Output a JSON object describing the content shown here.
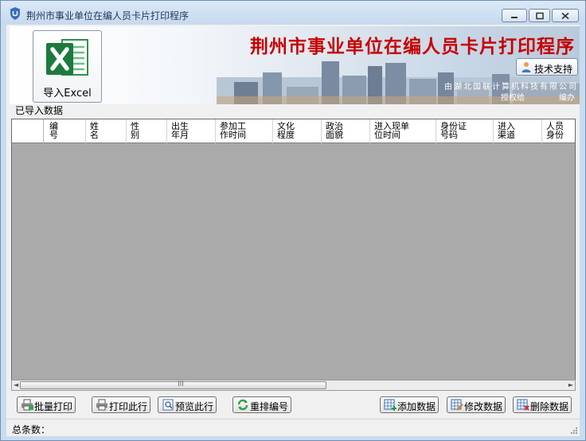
{
  "window": {
    "title": "荆州市事业单位在编人员卡片打印程序"
  },
  "banner": {
    "title": "荆州市事业单位在编人员卡片打印程序",
    "support_button": "技术支持",
    "company": "由湖北国联计算机科技有限公司",
    "authorized": "授权给",
    "compiled": "编办"
  },
  "import_button": {
    "label": "导入Excel",
    "icon": "excel-icon"
  },
  "section": {
    "label": "已导入数据"
  },
  "table": {
    "columns": [
      {
        "label": "编\n号"
      },
      {
        "label": "姓\n名"
      },
      {
        "label": "性\n别"
      },
      {
        "label": "出生\n年月"
      },
      {
        "label": "参加工\n作时间"
      },
      {
        "label": "文化\n程度"
      },
      {
        "label": "政治\n面貌"
      },
      {
        "label": "进入现单\n位时间"
      },
      {
        "label": "身份证\n号码"
      },
      {
        "label": "进入\n渠道"
      },
      {
        "label": "人员\n身份"
      }
    ],
    "rows": []
  },
  "scrollbar": {
    "left_arrow": "◄",
    "right_arrow": "►",
    "grip": "III"
  },
  "buttons": {
    "batch_print": "批量打印",
    "print_row": "打印此行",
    "preview_row": "预览此行",
    "renumber": "重排编号",
    "add_data": "添加数据",
    "edit_data": "修改数据",
    "delete_data": "删除数据"
  },
  "status": {
    "total_label": "总条数：",
    "total_value": ""
  },
  "colors": {
    "title_red": "#c80000",
    "grid_background": "#aaaaaa",
    "window_frame": "#c9dcef"
  }
}
